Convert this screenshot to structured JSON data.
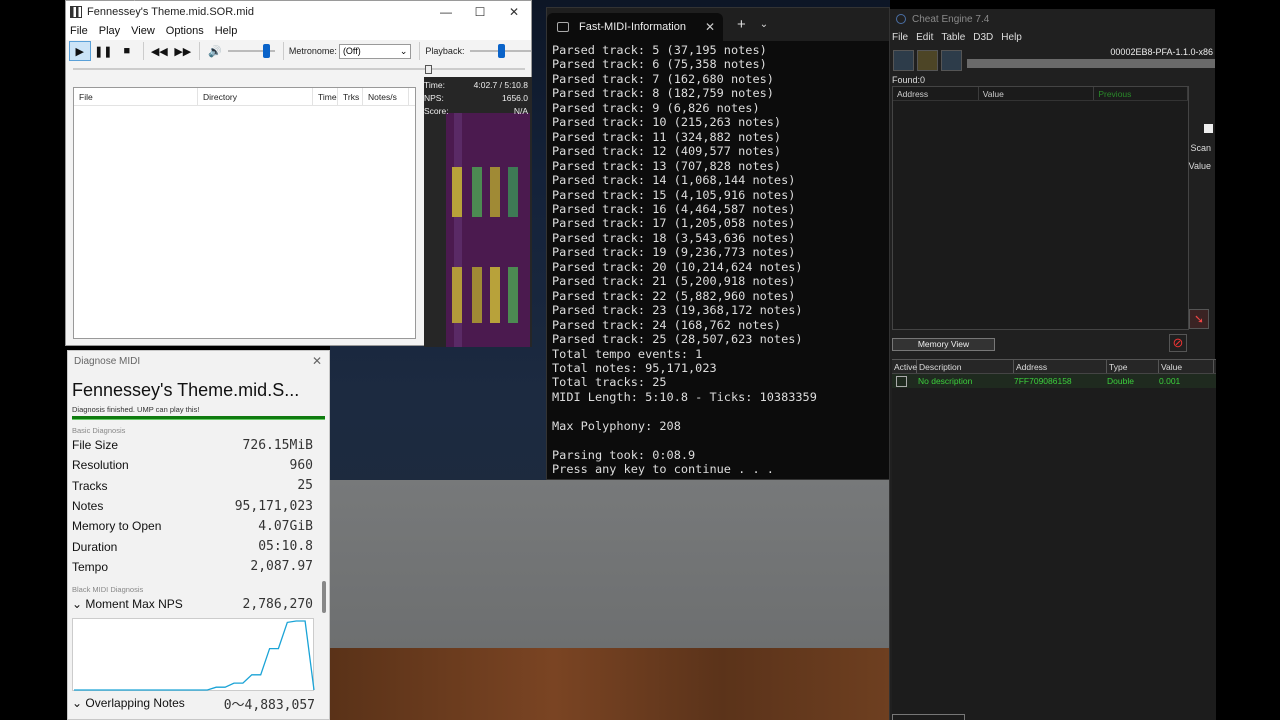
{
  "player": {
    "title": "Fennessey's Theme.mid.SOR.mid",
    "window_controls": [
      "—",
      "☐",
      "✕"
    ],
    "menu": [
      "File",
      "Play",
      "View",
      "Options",
      "Help"
    ],
    "toolbar": {
      "metronome_label": "Metronome:",
      "metronome_value": "(Off)",
      "playback_label": "Playback:",
      "volume_level": 0.85,
      "playback_speed": 0.5
    },
    "seek_position": 0.79,
    "file_table": {
      "columns": [
        "File",
        "Directory",
        "Time",
        "Trks",
        "Notes/s"
      ]
    },
    "stats": [
      {
        "label": "Time:",
        "value": "4:02.7 / 5:10.8"
      },
      {
        "label": "NPS:",
        "value": "1656.0"
      },
      {
        "label": "Score:",
        "value": "N/A"
      }
    ]
  },
  "diagnose": {
    "title": "Diagnose MIDI",
    "heading": "Fennessey's Theme.mid.S...",
    "status": "Diagnosis finished. UMP can play this!",
    "basic_section": "Basic Diagnosis",
    "basic_rows": [
      {
        "key": "File Size",
        "value": "726.15MiB"
      },
      {
        "key": "Resolution",
        "value": "960"
      },
      {
        "key": "Tracks",
        "value": "25"
      },
      {
        "key": "Notes",
        "value": "95,171,023"
      },
      {
        "key": "Memory to Open",
        "value": "4.07GiB"
      },
      {
        "key": "Duration",
        "value": "05:10.8"
      },
      {
        "key": "Tempo",
        "value": "2,087.97"
      }
    ],
    "black_section": "Black MIDI Diagnosis",
    "moment_label": "Moment Max NPS",
    "moment_value": "2,786,270",
    "overlap_label": "Overlapping Notes",
    "overlap_value": "0〜4,883,057",
    "nps_graph": [
      0,
      0,
      0,
      0,
      0,
      0,
      0,
      0,
      0,
      0,
      0,
      0,
      0,
      0,
      0,
      0,
      0.04,
      0.04,
      0.1,
      0.1,
      0.22,
      0.22,
      0.6,
      0.6,
      0.98,
      1,
      1,
      0
    ]
  },
  "terminal": {
    "tab_title": "Fast-MIDI-Information",
    "lines": [
      "Parsed track: 5 (37,195 notes)",
      "Parsed track: 6 (75,358 notes)",
      "Parsed track: 7 (162,680 notes)",
      "Parsed track: 8 (182,759 notes)",
      "Parsed track: 9 (6,826 notes)",
      "Parsed track: 10 (215,263 notes)",
      "Parsed track: 11 (324,882 notes)",
      "Parsed track: 12 (409,577 notes)",
      "Parsed track: 13 (707,828 notes)",
      "Parsed track: 14 (1,068,144 notes)",
      "Parsed track: 15 (4,105,916 notes)",
      "Parsed track: 16 (4,464,587 notes)",
      "Parsed track: 17 (1,205,058 notes)",
      "Parsed track: 18 (3,543,636 notes)",
      "Parsed track: 19 (9,236,773 notes)",
      "Parsed track: 20 (10,214,624 notes)",
      "Parsed track: 21 (5,200,918 notes)",
      "Parsed track: 22 (5,882,960 notes)",
      "Parsed track: 23 (19,368,172 notes)",
      "Parsed track: 24 (168,762 notes)",
      "Parsed track: 25 (28,507,623 notes)",
      "Total tempo events: 1",
      "Total notes: 95,171,023",
      "Total tracks: 25",
      "MIDI Length: 5:10.8 - Ticks: 10383359",
      "",
      "Max Polyphony: 208",
      "",
      "Parsing took: 0:08.9",
      "Press any key to continue . . ."
    ]
  },
  "cheat_engine": {
    "title": "Cheat Engine 7.4",
    "menu": [
      "File",
      "Edit",
      "Table",
      "D3D",
      "Help"
    ],
    "process": "00002EB8-PFA-1.1.0-x86",
    "found": "Found:0",
    "result_columns": [
      "Address",
      "Value",
      "Previous"
    ],
    "scan_label": "Scan",
    "value_label": "Value",
    "memory_view": "Memory View",
    "address_columns": [
      "Active",
      "Description",
      "Address",
      "Type",
      "Value"
    ],
    "entry": {
      "description": "No description",
      "address": "7FF709086158",
      "type": "Double",
      "value": "0.001"
    }
  },
  "colors": {
    "terminal_text": "#dddddd",
    "ce_entry": "#3ccf3c",
    "graph_line": "#1aa3d6",
    "progress": "#0f7b0f"
  }
}
